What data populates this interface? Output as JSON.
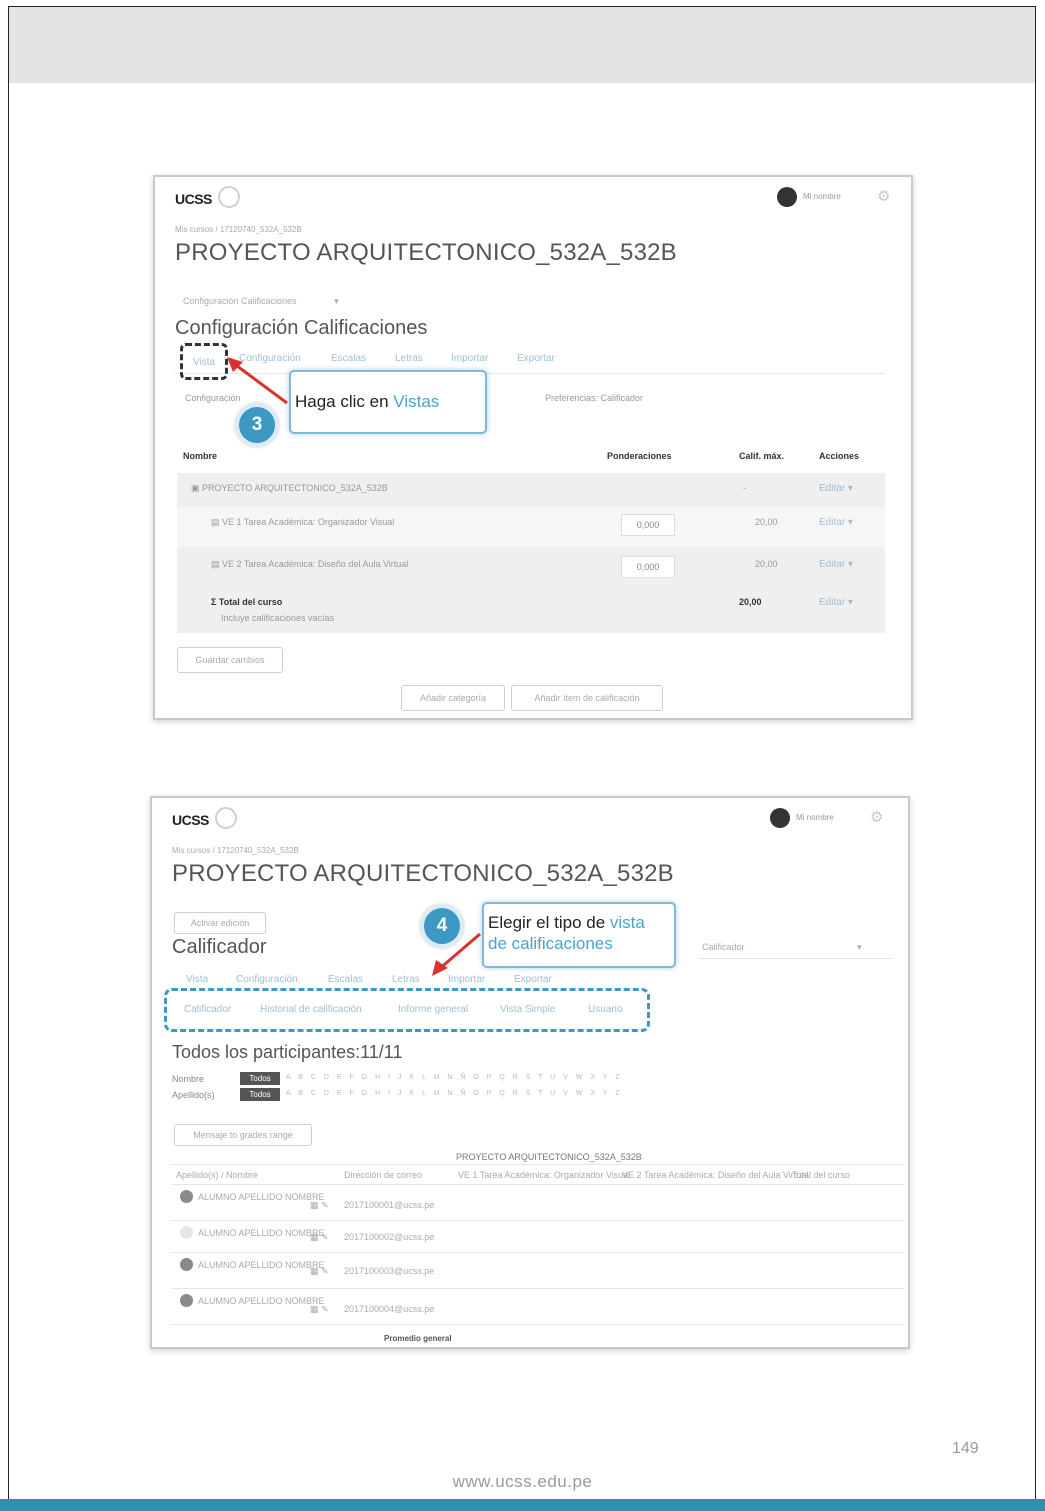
{
  "page": {
    "number": "149",
    "footer_url": "www.ucss.edu.pe"
  },
  "shot1": {
    "logo": "UCSS",
    "user_name": "Mi nombre",
    "breadcrumb": "Mis cursos / 17120740_532A_532B",
    "course_title": "PROYECTO ARQUITECTONICO_532A_532B",
    "dropdown": "Configuración Calificaciones",
    "section_title": "Configuración Calificaciones",
    "tabs": [
      "Vista",
      "Configuración",
      "Escalas",
      "Letras",
      "Importar",
      "Exportar"
    ],
    "subtabs": [
      "Configuración",
      "Preferencias: Calificador"
    ],
    "callout_prefix": "Haga clic en ",
    "callout_link": "Vistas",
    "step": "3",
    "columns": {
      "name": "Nombre",
      "weights": "Ponderaciones",
      "max": "Calif. máx.",
      "actions": "Acciones"
    },
    "category_row": {
      "name": "PROYECTO ARQUITECTONICO_532A_532B",
      "max": "-",
      "action": "Editar"
    },
    "items": [
      {
        "name": "VE 1 Tarea Académica: Organizador Visual",
        "weight": "0,000",
        "max": "20,00",
        "action": "Editar"
      },
      {
        "name": "VE 2 Tarea Académica: Diseño del Aula Virtual",
        "weight": "0,000",
        "max": "20,00",
        "action": "Editar"
      }
    ],
    "total": {
      "name": "Total del curso",
      "note": "Incluye calificaciones vacías",
      "max": "20,00",
      "action": "Editar"
    },
    "save_button": "Guardar cambios",
    "add_category_button": "Añadir categoría",
    "add_item_button": "Añadir ítem de calificación"
  },
  "shot2": {
    "logo": "UCSS",
    "user_name": "Mi nombre",
    "breadcrumb": "Mis cursos / 17120740_532A_532B",
    "course_title": "PROYECTO ARQUITECTONICO_532A_532B",
    "edit_button": "Activar edición",
    "section_title": "Calificador",
    "select_value": "Calificador",
    "tabs": [
      "Vista",
      "Configuración",
      "Escalas",
      "Letras",
      "Importar",
      "Exportar"
    ],
    "views": [
      "Calificador",
      "Historial de calificación",
      "Informe general",
      "Vista Simple",
      "Usuario"
    ],
    "callout_prefix": "Elegir el tipo de ",
    "callout_link_line1": "vista",
    "callout_link_line2": "de calificaciones",
    "step": "4",
    "participants": "Todos los participantes:11/11",
    "name_label": "Nombre",
    "surname_label": "Apellido(s)",
    "all_label": "Todos",
    "letters": "A B C D E F G H I J K L M N Ñ O P Q R S T U V W X Y Z",
    "message_button": "Mensaje to grades range",
    "course_header": "PROYECTO ARQUITECTONICO_532A_532B",
    "col_surname": "Apellido(s) / Nombre",
    "col_email": "Dirección de correo",
    "col_item1": "VE 1 Tarea Académica: Organizador Visual",
    "col_item2": "VE 2 Tarea Académica: Diseño del Aula Virtual",
    "col_total": "Total del curso",
    "students": [
      {
        "name": "ALUMNO APELLIDO NOMBRE",
        "email": "2017100001@ucss.pe"
      },
      {
        "name": "ALUMNO APELLIDO NOMBRE",
        "email": "2017100002@ucss.pe"
      },
      {
        "name": "ALUMNO APELLIDO NOMBRE",
        "email": "2017100003@ucss.pe"
      },
      {
        "name": "ALUMNO APELLIDO NOMBRE",
        "email": "2017100004@ucss.pe"
      }
    ],
    "overall_avg": "Promedio general"
  }
}
